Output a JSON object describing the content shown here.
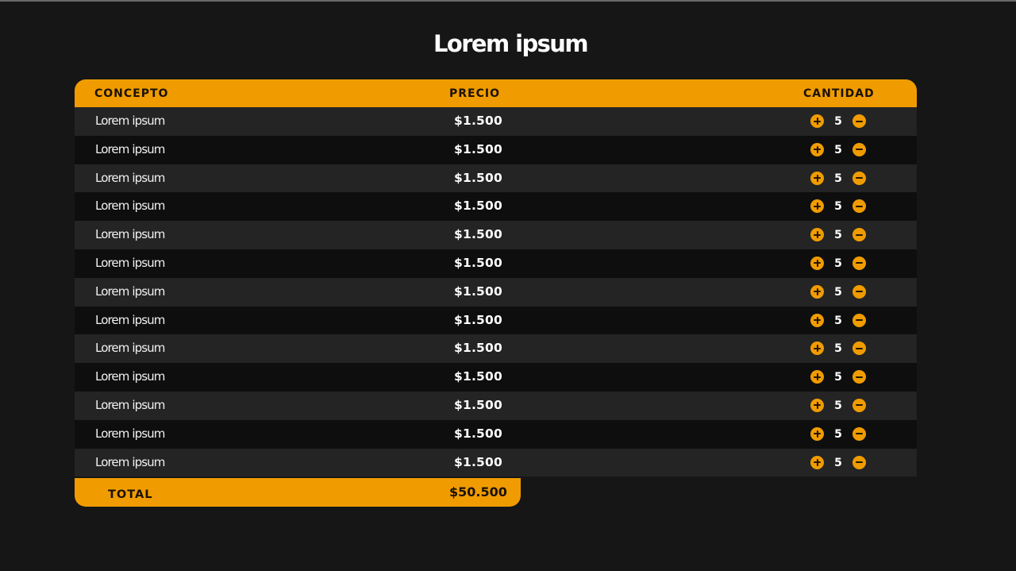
{
  "title": "Lorem ipsum",
  "colors": {
    "accent": "#f09c00",
    "background": "#161616",
    "row_light": "#242424",
    "row_dark": "#0e0e0e"
  },
  "table": {
    "headers": {
      "concepto": "CONCEPTO",
      "precio": "PRECIO",
      "cantidad": "CANTIDAD"
    },
    "rows": [
      {
        "concepto": "Lorem ipsum",
        "precio": "$1.500",
        "cantidad": "5"
      },
      {
        "concepto": "Lorem ipsum",
        "precio": "$1.500",
        "cantidad": "5"
      },
      {
        "concepto": "Lorem ipsum",
        "precio": "$1.500",
        "cantidad": "5"
      },
      {
        "concepto": "Lorem ipsum",
        "precio": "$1.500",
        "cantidad": "5"
      },
      {
        "concepto": "Lorem ipsum",
        "precio": "$1.500",
        "cantidad": "5"
      },
      {
        "concepto": "Lorem ipsum",
        "precio": "$1.500",
        "cantidad": "5"
      },
      {
        "concepto": "Lorem ipsum",
        "precio": "$1.500",
        "cantidad": "5"
      },
      {
        "concepto": "Lorem ipsum",
        "precio": "$1.500",
        "cantidad": "5"
      },
      {
        "concepto": "Lorem ipsum",
        "precio": "$1.500",
        "cantidad": "5"
      },
      {
        "concepto": "Lorem ipsum",
        "precio": "$1.500",
        "cantidad": "5"
      },
      {
        "concepto": "Lorem ipsum",
        "precio": "$1.500",
        "cantidad": "5"
      },
      {
        "concepto": "Lorem ipsum",
        "precio": "$1.500",
        "cantidad": "5"
      },
      {
        "concepto": "Lorem ipsum",
        "precio": "$1.500",
        "cantidad": "5"
      }
    ],
    "quantity_controls": {
      "increment_icon": "plus-circle-icon",
      "decrement_icon": "minus-circle-icon"
    }
  },
  "total": {
    "label": "TOTAL",
    "value": "$50.500"
  }
}
